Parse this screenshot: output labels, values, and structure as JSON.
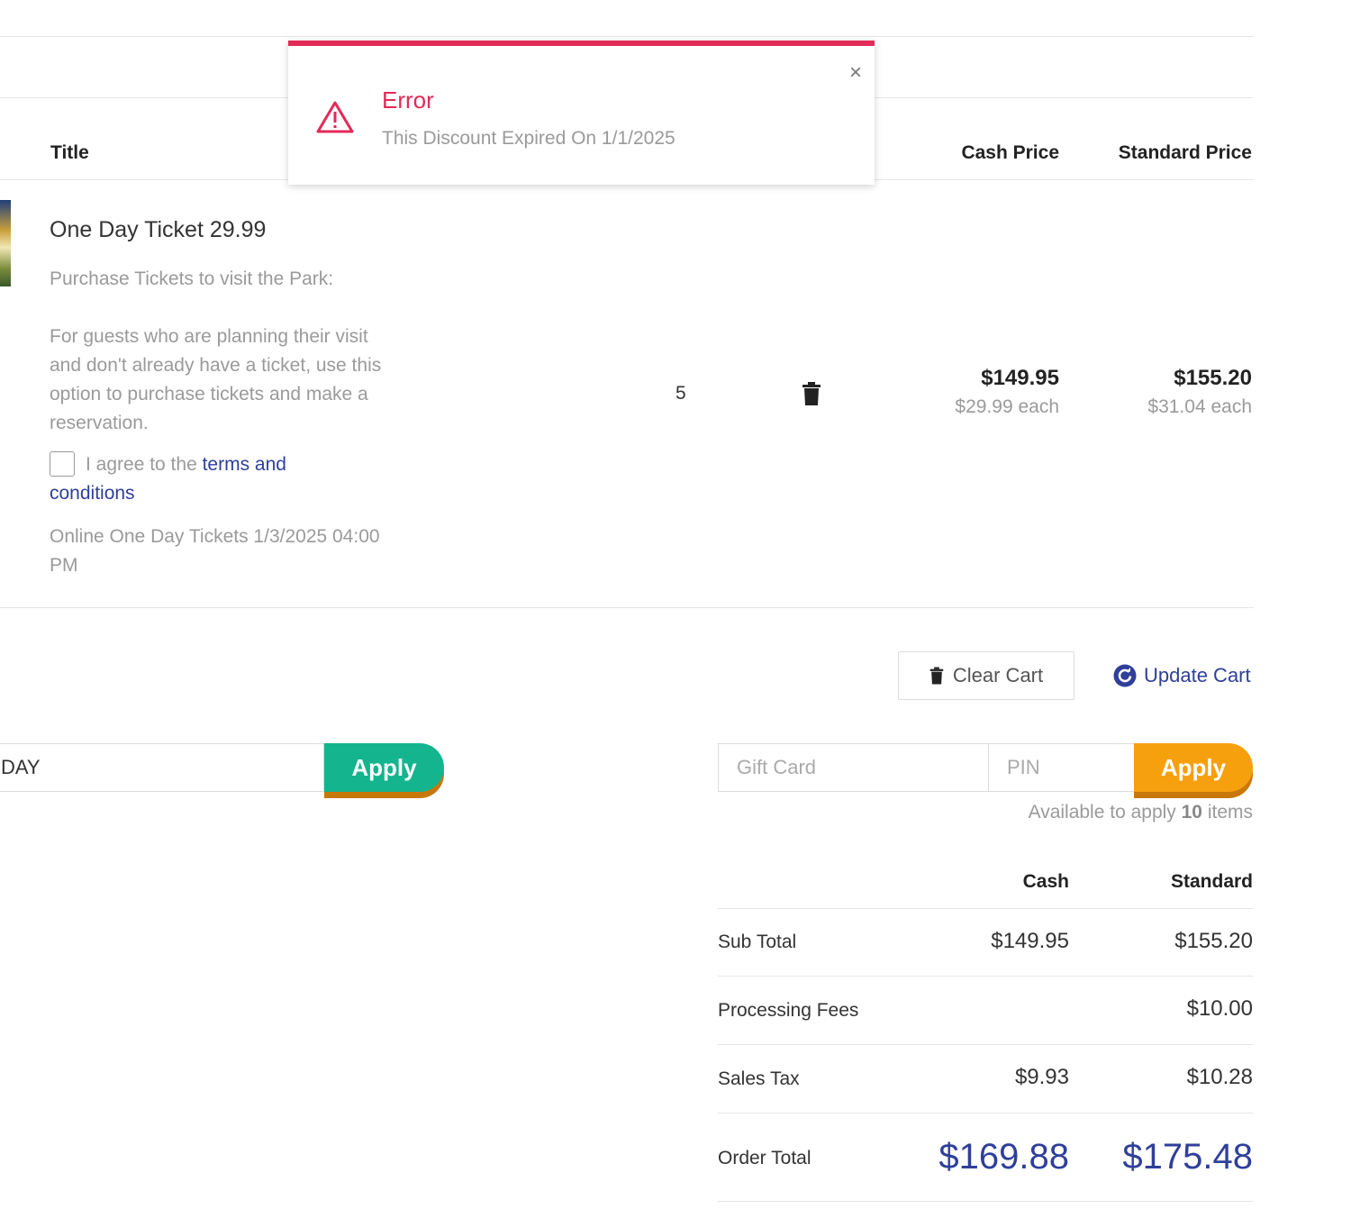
{
  "table": {
    "headers": {
      "title": "Title",
      "cash_price": "Cash Price",
      "standard_price": "Standard Price"
    }
  },
  "item": {
    "title": "One Day Ticket 29.99",
    "desc_line1": "Purchase Tickets to visit the Park:",
    "desc_line2": "For guests who are planning their visit and don't already have a ticket, use this option to purchase tickets and make a reservation.",
    "agree_prefix": "I agree to the ",
    "agree_link": "terms and conditions",
    "event_info": "Online One Day Tickets 1/3/2025 04:00 PM",
    "quantity": "5",
    "cash_total": "$149.95",
    "cash_each": "$29.99 each",
    "standard_total": "$155.20",
    "standard_each": "$31.04 each"
  },
  "cart_actions": {
    "clear": "Clear Cart",
    "update": "Update Cart"
  },
  "discount": {
    "value": "DAY",
    "apply": "Apply"
  },
  "gift_card": {
    "card_placeholder": "Gift Card",
    "pin_placeholder": "PIN",
    "apply": "Apply",
    "available_prefix": "Available to apply ",
    "available_count": "10",
    "available_suffix": " items"
  },
  "summary": {
    "col_cash": "Cash",
    "col_standard": "Standard",
    "rows": [
      {
        "label": "Sub Total",
        "cash": "$149.95",
        "standard": "$155.20"
      },
      {
        "label": "Processing Fees",
        "cash": "",
        "standard": "$10.00"
      },
      {
        "label": "Sales Tax",
        "cash": "$9.93",
        "standard": "$10.28"
      }
    ],
    "total_label": "Order Total",
    "total_cash": "$169.88",
    "total_standard": "$175.48"
  },
  "toast": {
    "title": "Error",
    "message": "This Discount Expired On 1/1/2025",
    "close": "×"
  },
  "colors": {
    "accent": "#2f3f9a",
    "error": "#e32a57",
    "apply_green": "#14b48e",
    "apply_orange": "#f7a00e"
  }
}
